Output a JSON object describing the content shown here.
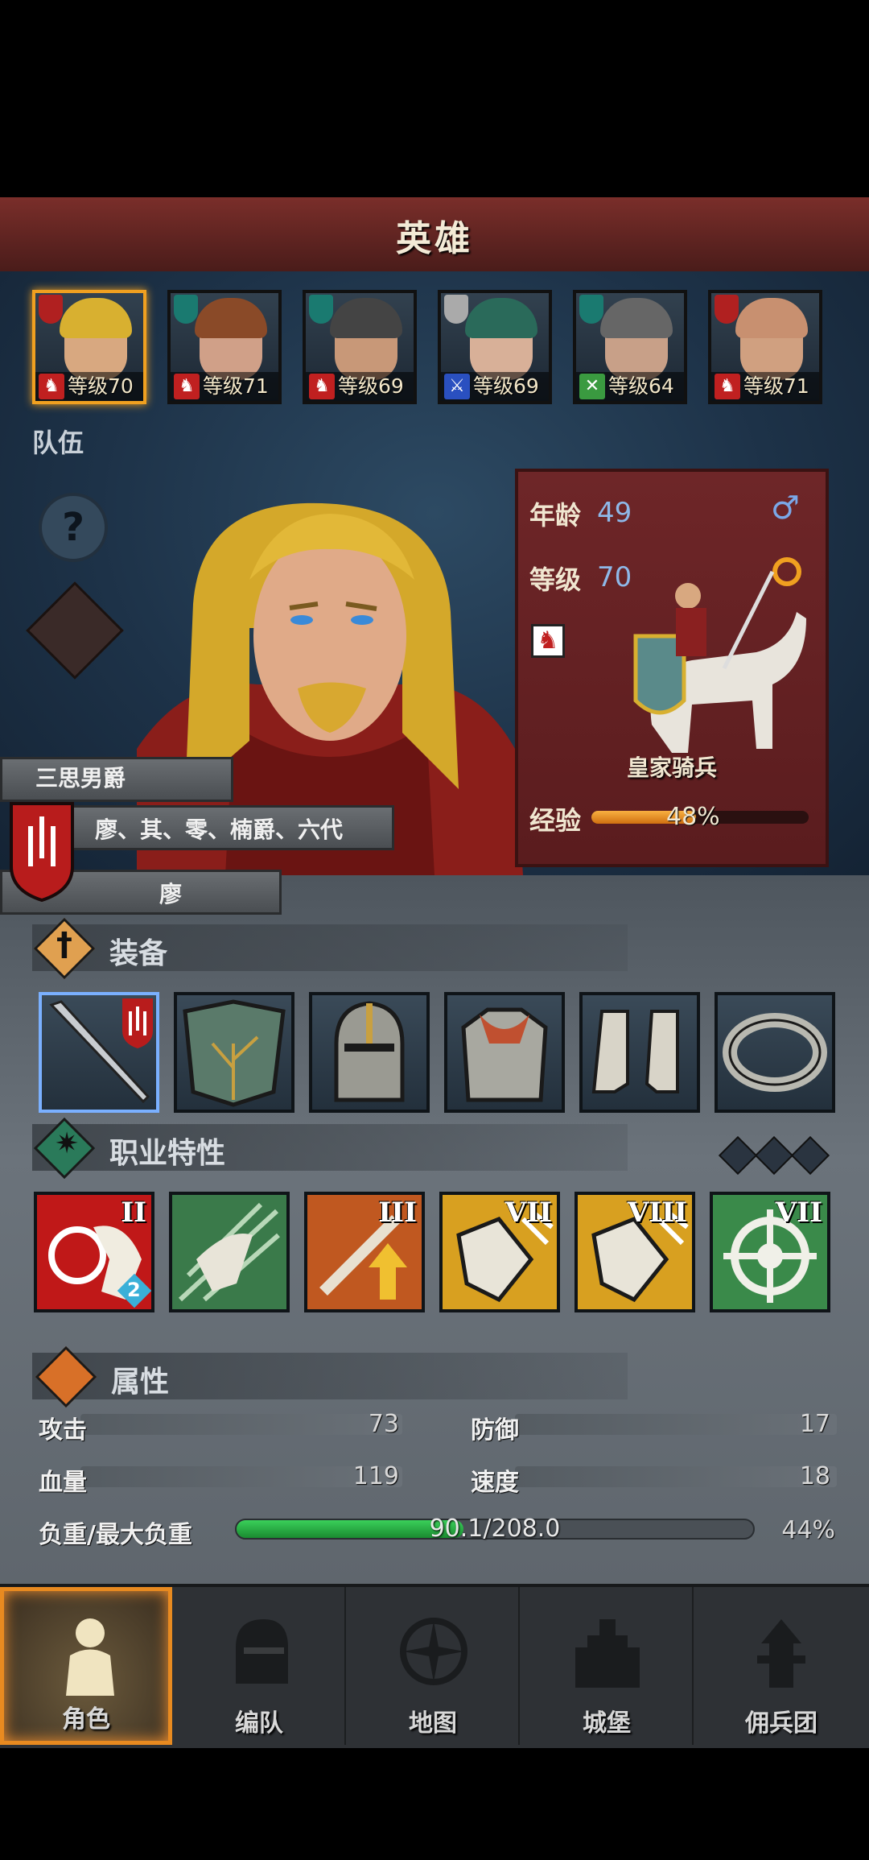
{
  "header": {
    "title": "英雄"
  },
  "roster": [
    {
      "level_label": "等级70",
      "class_icon": "horse-icon",
      "selected": true
    },
    {
      "level_label": "等级71",
      "class_icon": "horse-icon",
      "selected": false
    },
    {
      "level_label": "等级69",
      "class_icon": "horse-icon",
      "selected": false
    },
    {
      "level_label": "等级69",
      "class_icon": "sword-icon",
      "selected": false
    },
    {
      "level_label": "等级64",
      "class_icon": "crossbow-icon",
      "selected": false
    },
    {
      "level_label": "等级71",
      "class_icon": "horse-icon",
      "selected": false
    }
  ],
  "team_label": "队伍",
  "hero": {
    "age_label": "年龄",
    "age": "49",
    "gender_icon": "male-icon",
    "level_label": "等级",
    "level": "70",
    "unit_name": "皇家骑兵",
    "exp_label": "经验",
    "exp_percent": "48%",
    "exp_fraction": 0.48,
    "title": "三思男爵",
    "lineage": "廖、其、零、楠爵、六代",
    "family": "廖"
  },
  "equipment": {
    "title": "装备",
    "slots": [
      "sword",
      "shield",
      "helmet",
      "armor",
      "boots",
      "ring"
    ]
  },
  "traits": {
    "title": "职业特性",
    "ranks": [
      "II",
      "",
      "III",
      "VII",
      "VIII",
      "VII"
    ],
    "badge": "2"
  },
  "attributes": {
    "title": "属性",
    "attack_label": "攻击",
    "attack": "73",
    "defense_label": "防御",
    "defense": "17",
    "hp_label": "血量",
    "hp": "119",
    "speed_label": "速度",
    "speed": "18",
    "weight_label": "负重/最大负重",
    "weight": "90.1/208.0",
    "weight_percent": "44%",
    "weight_fraction": 0.44
  },
  "nav": [
    {
      "label": "角色",
      "icon": "knight-icon",
      "active": true
    },
    {
      "label": "编队",
      "icon": "helmet-icon",
      "active": false
    },
    {
      "label": "地图",
      "icon": "compass-icon",
      "active": false
    },
    {
      "label": "城堡",
      "icon": "castle-icon",
      "active": false
    },
    {
      "label": "佣兵团",
      "icon": "mercenary-icon",
      "active": false
    }
  ],
  "colors": {
    "accent": "#f0a020",
    "exp": "#f0a030",
    "weight": "#2fb84a",
    "panel": "#6a2426"
  }
}
